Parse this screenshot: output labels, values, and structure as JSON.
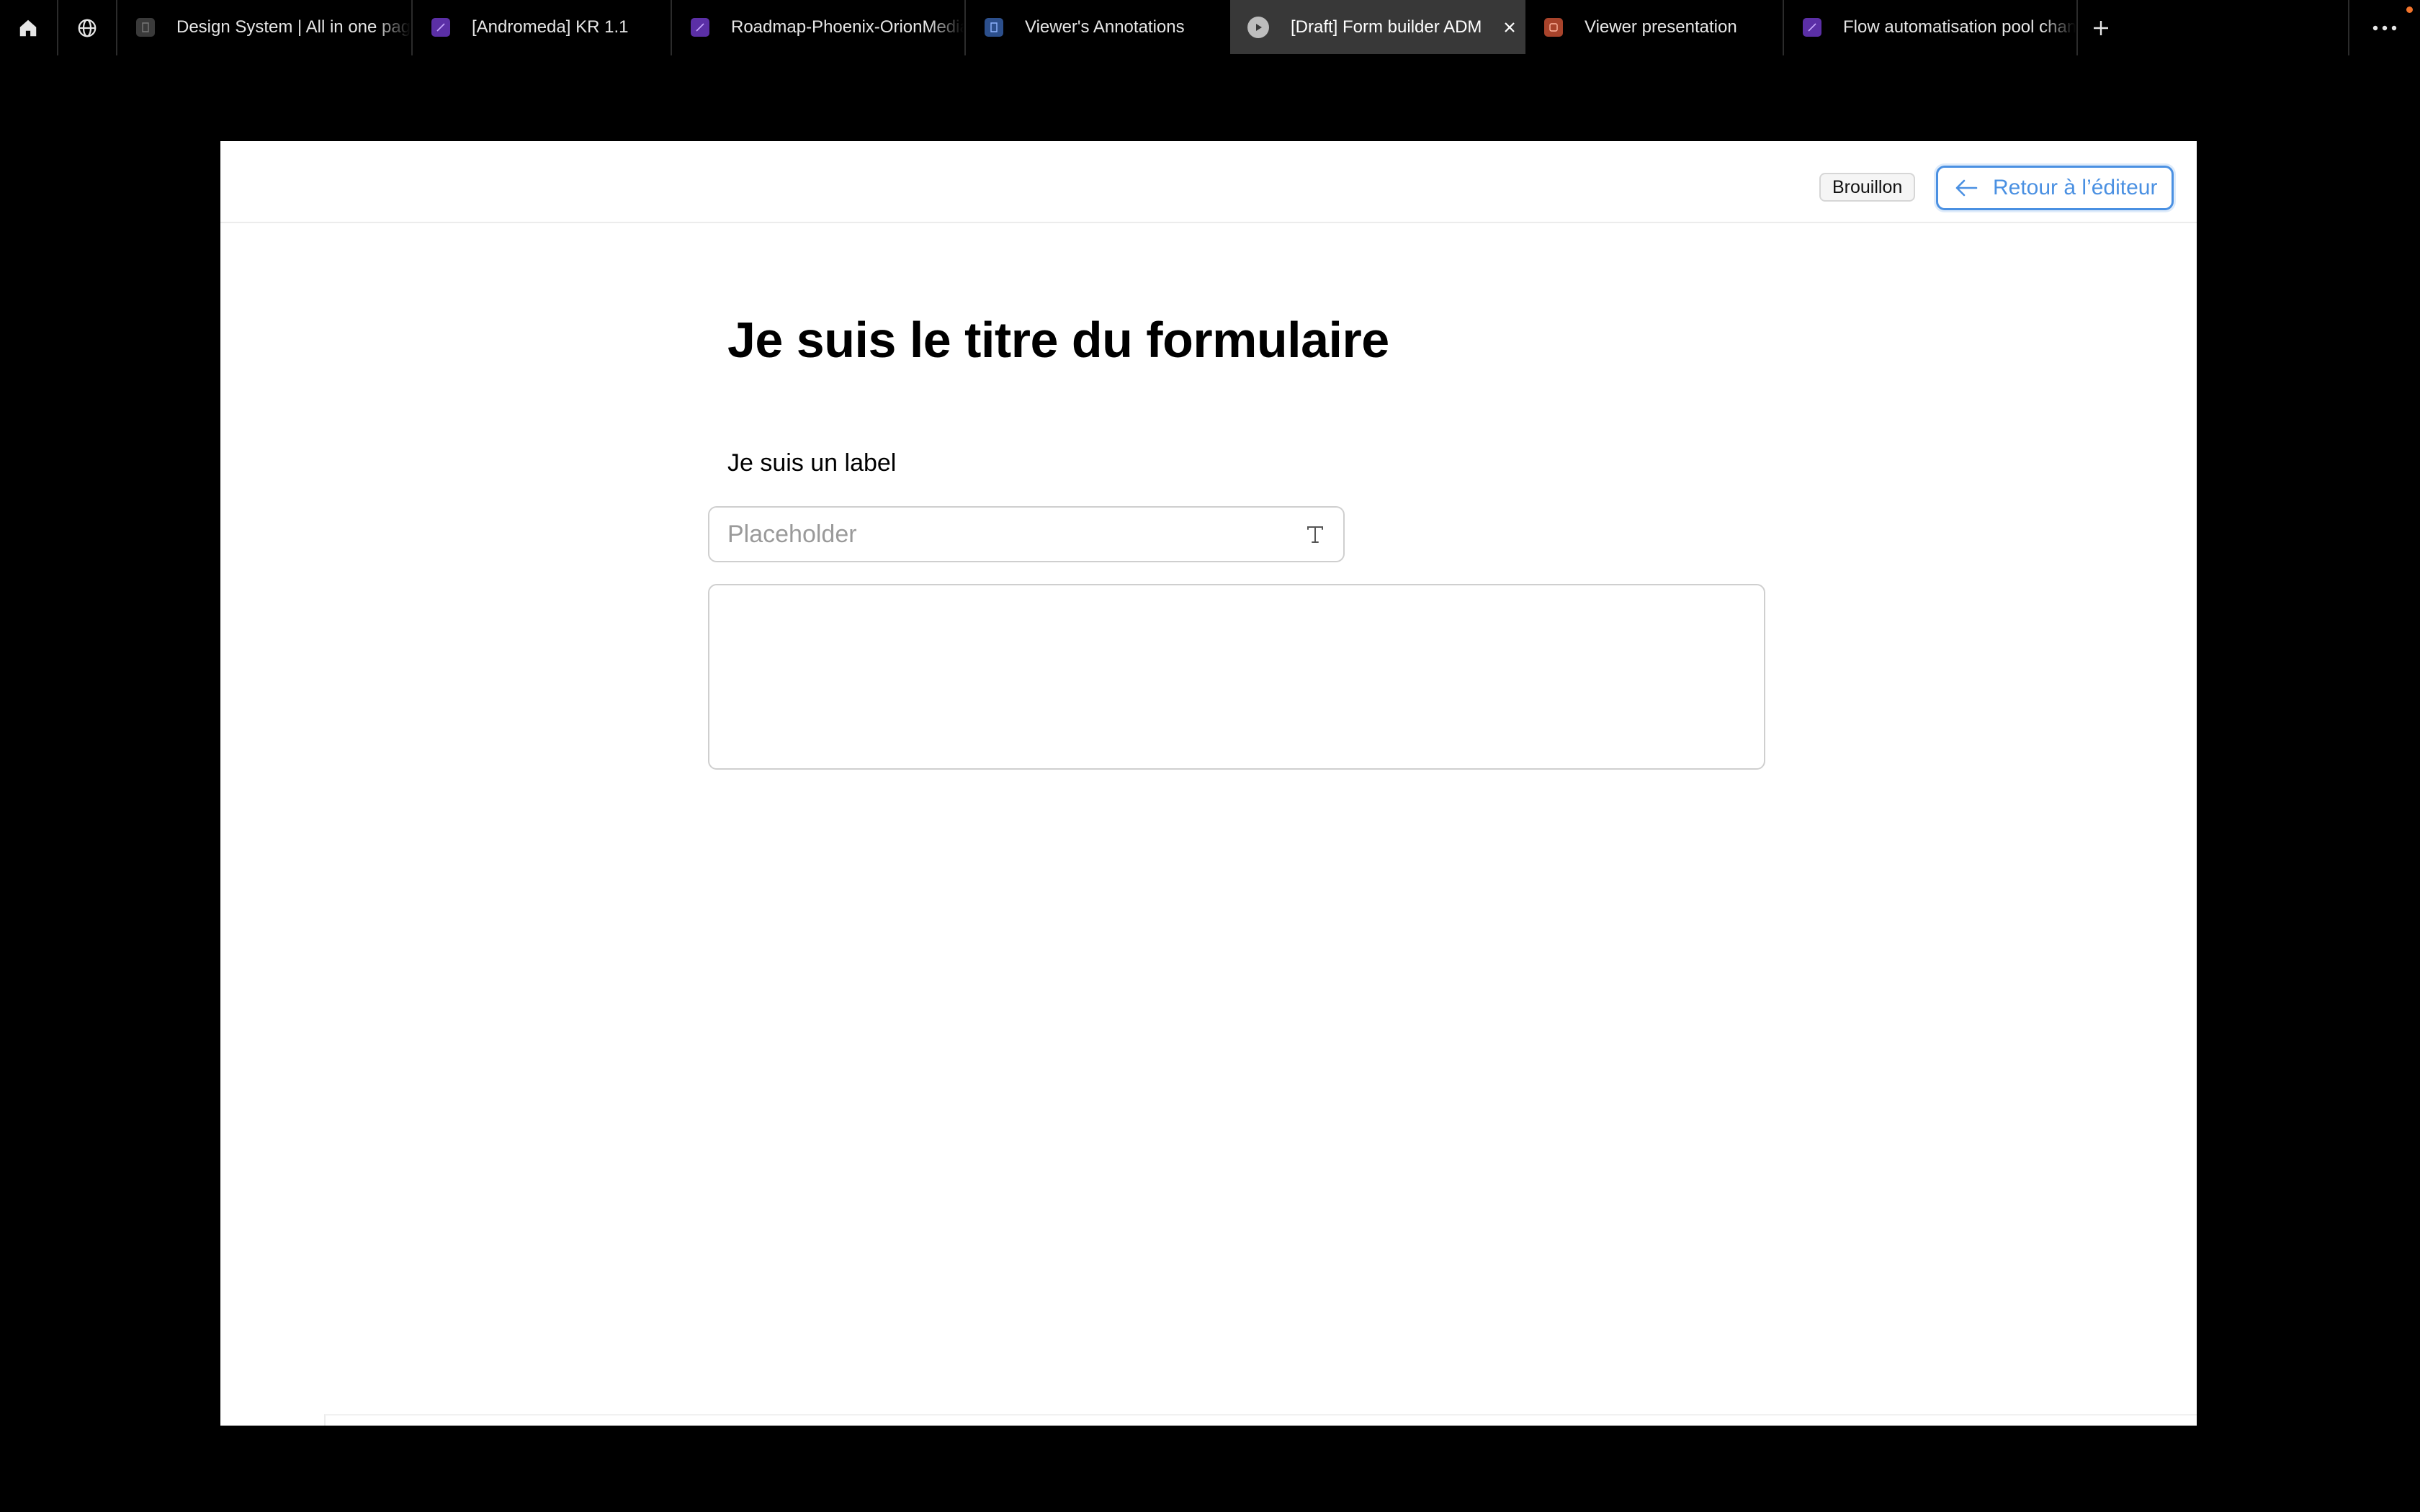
{
  "colors": {
    "accent": "#4a90e2",
    "tabbar_bg": "#000000",
    "active_tab_bg": "#383838",
    "frame_bg": "#ffffff",
    "notification": "#f2742b"
  },
  "tabbar": {
    "home_icon": "home-icon",
    "community_icon": "globe-icon",
    "tabs": [
      {
        "label": "Design System | All in one page",
        "icon": "design-file-icon",
        "icon_color": "#3a3a3a",
        "active": false
      },
      {
        "label": "[Andromeda] KR 1.1",
        "icon": "figjam-file-icon",
        "icon_color": "#5b2fa6",
        "active": false
      },
      {
        "label": "Roadmap-Phoenix-OrionMedia",
        "icon": "figjam-file-icon",
        "icon_color": "#5b2fa6",
        "active": false
      },
      {
        "label": "Viewer's Annotations",
        "icon": "design-file-icon",
        "icon_color": "#2c4f8c",
        "active": false
      },
      {
        "label": "[Draft] Form builder ADM",
        "icon": "play-icon",
        "icon_color": "#bdbdbd",
        "active": true
      },
      {
        "label": "Viewer presentation",
        "icon": "slides-file-icon",
        "icon_color": "#a8432b",
        "active": false
      },
      {
        "label": "Flow automatisation pool chantier",
        "icon": "figjam-file-icon",
        "icon_color": "#5b2fa6",
        "active": false
      }
    ],
    "new_tab_icon": "plus-icon",
    "more_icon": "more-horizontal-icon"
  },
  "header": {
    "status_badge": "Brouillon",
    "back_button": "Retour à l’éditeur"
  },
  "form": {
    "title": "Je suis le titre du formulaire",
    "field_label": "Je suis un label",
    "input_placeholder": "Placeholder",
    "input_value": "",
    "textarea_value": ""
  }
}
